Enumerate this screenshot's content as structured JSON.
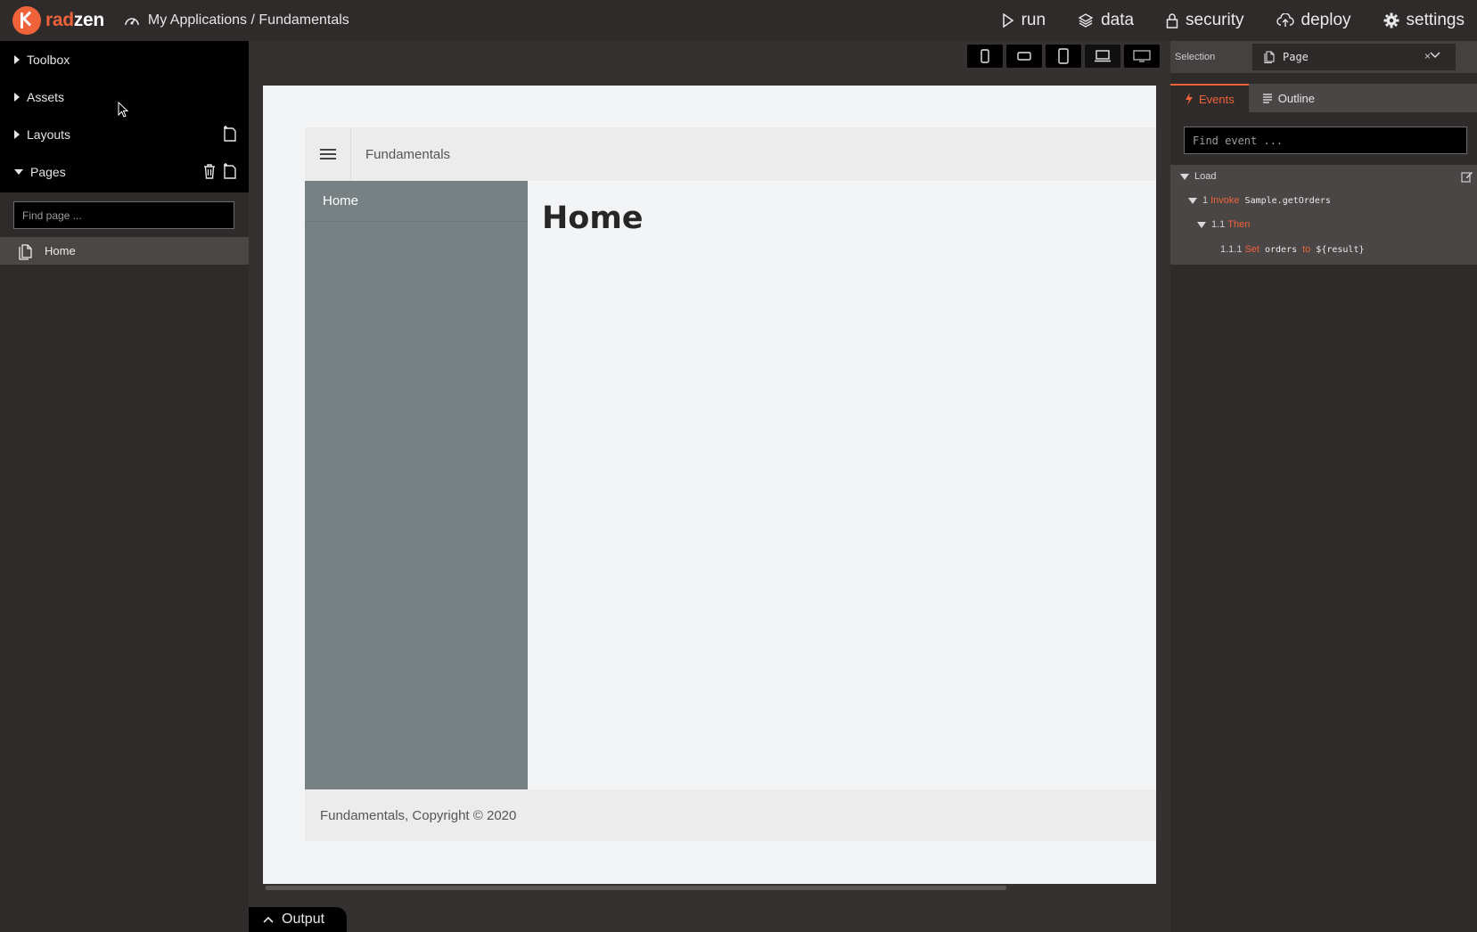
{
  "app": {
    "logo_part1": "rad",
    "logo_part2": "zen",
    "breadcrumb": "My Applications / Fundamentals"
  },
  "topnav": {
    "run": "run",
    "data": "data",
    "security": "security",
    "deploy": "deploy",
    "settings": "settings"
  },
  "leftpanel": {
    "sections": {
      "toolbox": "Toolbox",
      "assets": "Assets",
      "layouts": "Layouts",
      "pages": "Pages"
    },
    "page_search_placeholder": "Find page ...",
    "pages": [
      "Home"
    ]
  },
  "canvas": {
    "app_title": "Fundamentals",
    "sidebar_items": [
      "Home"
    ],
    "heading": "Home",
    "footer": "Fundamentals, Copyright © 2020",
    "output_label": "Output"
  },
  "rightpanel": {
    "selection_label": "Selection",
    "selection_value": "Page",
    "selection_clear": "×",
    "tabs": {
      "events": "Events",
      "outline": "Outline"
    },
    "event_search_placeholder": "Find event ...",
    "events": {
      "load": "Load",
      "invoke_num": "1",
      "invoke_kw": "Invoke",
      "invoke_target": "Sample.getOrders",
      "then_num": "1.1",
      "then_kw": "Then",
      "set_num": "1.1.1",
      "set_kw": "Set",
      "set_name": "orders",
      "set_to": "to",
      "set_value": "${result}"
    }
  },
  "colors": {
    "accent": "#f0623a",
    "background": "#2f2b2a",
    "sidebar_preview": "#778184"
  }
}
